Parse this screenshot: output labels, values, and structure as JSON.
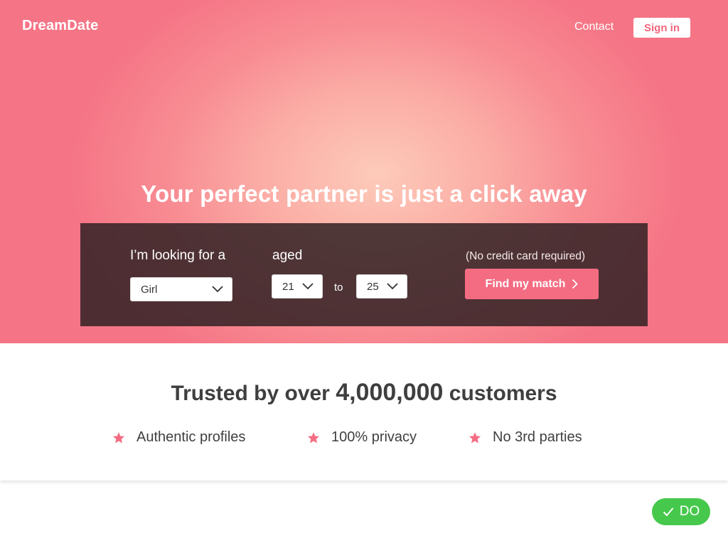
{
  "header": {
    "logo": "DreamDate",
    "contact_label": "Contact",
    "signin_label": "Sign in"
  },
  "hero": {
    "headline": "Your perfect partner is just a click away"
  },
  "search": {
    "looking_for_label": "I’m looking for a",
    "gender_value": "Girl",
    "aged_label": "aged",
    "age_min": "21",
    "to_label": "to",
    "age_max": "25",
    "no_cc_note": "(No credit card required)",
    "find_button_label": "Find my match"
  },
  "trust": {
    "prefix": "Trusted by over ",
    "count": "4,000,000",
    "suffix": " customers",
    "features": [
      {
        "icon": "star-icon",
        "label": "Authentic profiles"
      },
      {
        "icon": "star-icon",
        "label": "100% privacy"
      },
      {
        "icon": "star-icon",
        "label": "No 3rd parties"
      }
    ]
  },
  "badge": {
    "icon": "check-icon",
    "label": "DO"
  },
  "colors": {
    "accent_pink": "#f46c82",
    "panel_dark": "#3b2a2c",
    "text_dark": "#3f3f3f",
    "badge_green": "#46c84c"
  }
}
